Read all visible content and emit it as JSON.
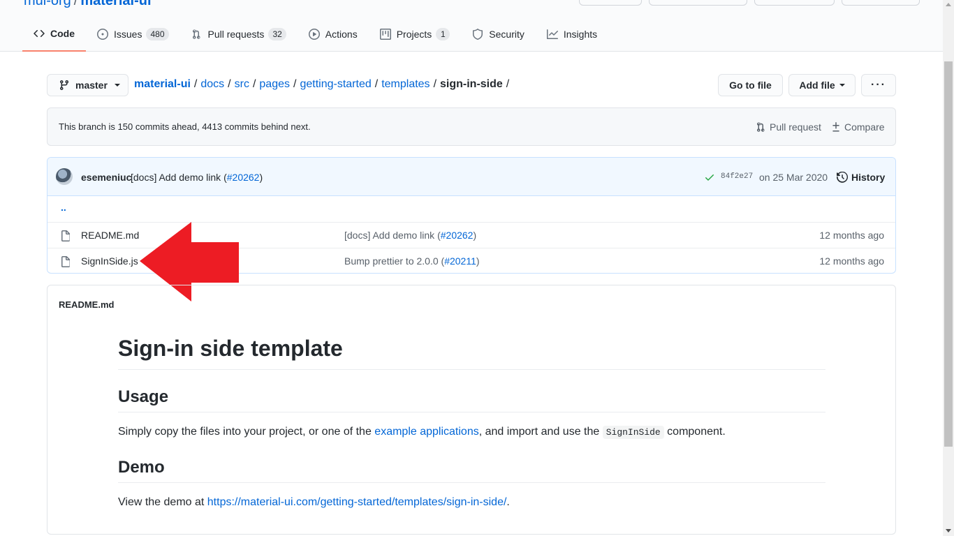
{
  "header": {
    "owner": "mui-org",
    "repo": "material-ui"
  },
  "tabs": [
    {
      "label": "Code",
      "icon": "code-icon"
    },
    {
      "label": "Issues",
      "count": "480",
      "icon": "issue-icon"
    },
    {
      "label": "Pull requests",
      "count": "32",
      "icon": "pull-request-icon"
    },
    {
      "label": "Actions",
      "icon": "play-icon"
    },
    {
      "label": "Projects",
      "count": "1",
      "icon": "project-icon"
    },
    {
      "label": "Security",
      "icon": "shield-icon"
    },
    {
      "label": "Insights",
      "icon": "graph-icon"
    }
  ],
  "nav": {
    "branch": "master",
    "path": [
      "material-ui",
      "docs",
      "src",
      "pages",
      "getting-started",
      "templates"
    ],
    "current": "sign-in-side",
    "trailing_sep": "/",
    "go_to_file": "Go to file",
    "add_file": "Add file",
    "more": "···"
  },
  "branch_info": {
    "text": "This branch is 150 commits ahead, 4413 commits behind next.",
    "pull_request": "Pull request",
    "compare": "Compare"
  },
  "latest_commit": {
    "author": "esemeniuc",
    "message_prefix": "[docs] Add demo link (",
    "message_link": "#20262",
    "message_suffix": ")",
    "sha": "84f2e27",
    "date": "on 25 Mar 2020",
    "history": "History"
  },
  "up_dir": "..",
  "files": [
    {
      "name": "README.md",
      "msg_prefix": "[docs] Add demo link (",
      "msg_link": "#20262",
      "msg_suffix": ")",
      "age": "12 months ago"
    },
    {
      "name": "SignInSide.js",
      "msg_prefix": "Bump prettier to 2.0.0 (",
      "msg_link": "#20211",
      "msg_suffix": ")",
      "age": "12 months ago"
    }
  ],
  "readme": {
    "filename": "README.md",
    "h1": "Sign-in side template",
    "usage_heading": "Usage",
    "usage_text_1": "Simply copy the files into your project, or one of the ",
    "usage_link": "example applications",
    "usage_text_2": ", and import and use the ",
    "usage_code": "SignInSide",
    "usage_text_3": " component.",
    "demo_heading": "Demo",
    "demo_text": "View the demo at ",
    "demo_link": "https://material-ui.com/getting-started/templates/sign-in-side/",
    "demo_suffix": "."
  },
  "colors": {
    "link": "#0366d6",
    "active_tab_underline": "#f9826c",
    "annotation_arrow": "#ed1c24",
    "success_check": "#28a745"
  }
}
